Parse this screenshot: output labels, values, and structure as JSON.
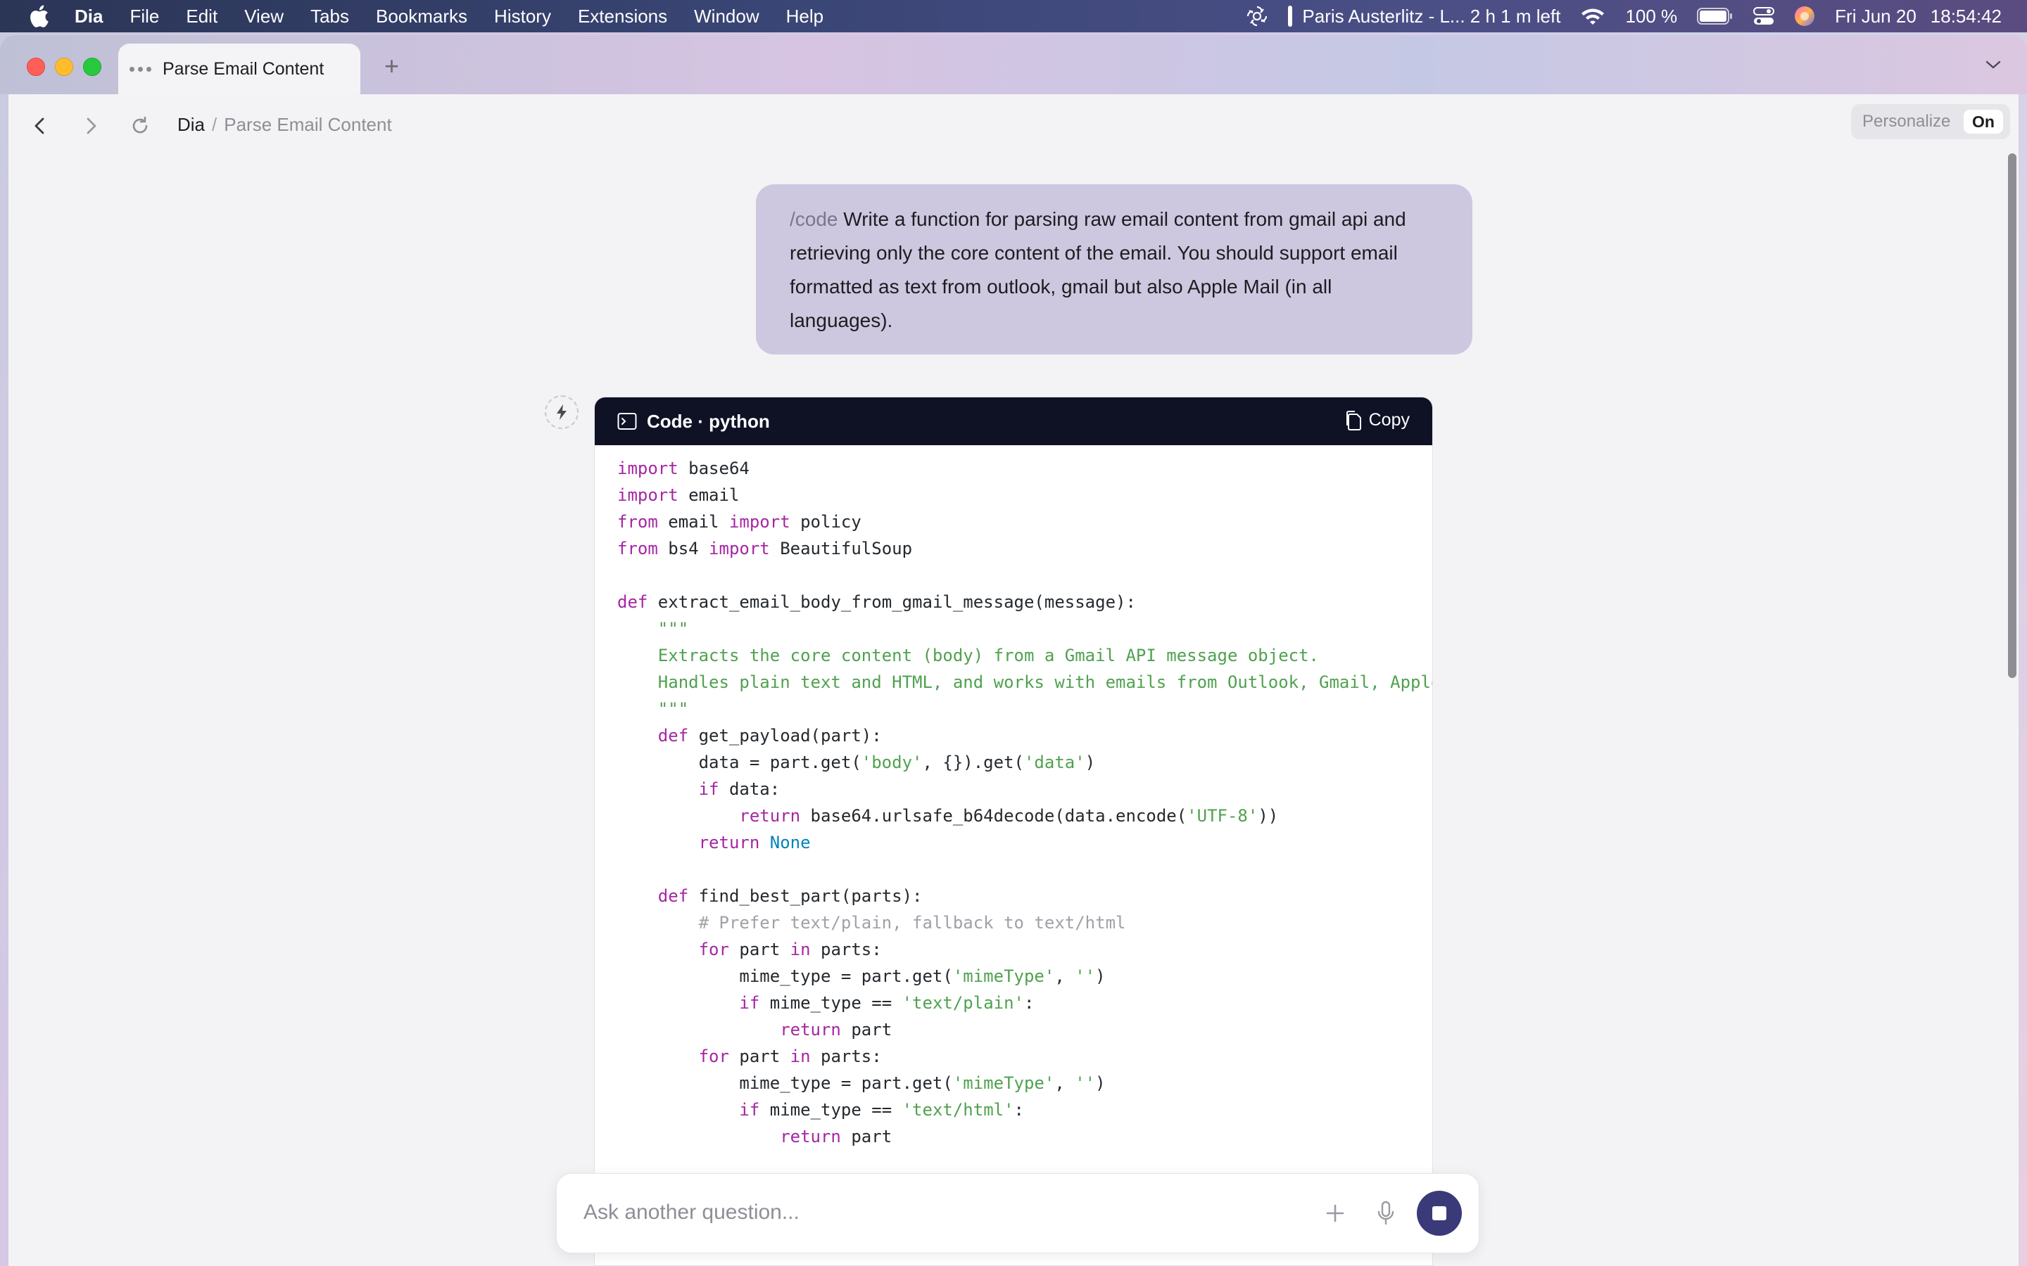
{
  "menubar": {
    "app": "Dia",
    "items": [
      "File",
      "Edit",
      "View",
      "Tabs",
      "Bookmarks",
      "History",
      "Extensions",
      "Window",
      "Help"
    ],
    "status": {
      "trip": "Paris Austerlitz - L... 2 h 1 m left",
      "battery": "100 %",
      "date": "Fri Jun 20",
      "time": "18:54:42"
    }
  },
  "tab": {
    "title": "Parse Email Content"
  },
  "toolbar": {
    "breadcrumb_root": "Dia",
    "breadcrumb_sep": "/",
    "breadcrumb_current": "Parse Email Content",
    "personalize_label": "Personalize",
    "personalize_state": "On"
  },
  "user_message": {
    "command": "/code",
    "text": " Write a function for parsing raw email content from gmail api and retrieving only the core content of the email. You should support email formatted as text from outlook, gmail but also Apple Mail (in all languages)."
  },
  "code_block": {
    "title": "Code · python",
    "copy_label": "Copy",
    "lines": [
      [
        [
          "kw",
          "import"
        ],
        [
          "",
          " base64"
        ]
      ],
      [
        [
          "kw",
          "import"
        ],
        [
          "",
          " email"
        ]
      ],
      [
        [
          "kw",
          "from"
        ],
        [
          "",
          " email "
        ],
        [
          "kw",
          "import"
        ],
        [
          "",
          " policy"
        ]
      ],
      [
        [
          "kw",
          "from"
        ],
        [
          "",
          " bs4 "
        ],
        [
          "kw",
          "import"
        ],
        [
          "",
          " BeautifulSoup"
        ]
      ],
      [],
      [
        [
          "kw",
          "def"
        ],
        [
          "",
          " extract_email_body_from_gmail_message(message):"
        ]
      ],
      [
        [
          "str",
          "    \"\"\""
        ]
      ],
      [
        [
          "str",
          "    Extracts the core content (body) from a Gmail API message object."
        ]
      ],
      [
        [
          "str",
          "    Handles plain text and HTML, and works with emails from Outlook, Gmail, Apple Mail"
        ]
      ],
      [
        [
          "str",
          "    \"\"\""
        ]
      ],
      [
        [
          "",
          "    "
        ],
        [
          "kw",
          "def"
        ],
        [
          "",
          " get_payload(part):"
        ]
      ],
      [
        [
          "",
          "        data = part.get("
        ],
        [
          "str",
          "'body'"
        ],
        [
          "",
          ", {}).get("
        ],
        [
          "str",
          "'data'"
        ],
        [
          "",
          ")"
        ]
      ],
      [
        [
          "",
          "        "
        ],
        [
          "kw",
          "if"
        ],
        [
          "",
          " data:"
        ]
      ],
      [
        [
          "",
          "            "
        ],
        [
          "kw",
          "return"
        ],
        [
          "",
          " base64.urlsafe_b64decode(data.encode("
        ],
        [
          "str",
          "'UTF-8'"
        ],
        [
          "",
          "))"
        ]
      ],
      [
        [
          "",
          "        "
        ],
        [
          "kw",
          "return"
        ],
        [
          "",
          " "
        ],
        [
          "cst",
          "None"
        ]
      ],
      [],
      [
        [
          "",
          "    "
        ],
        [
          "kw",
          "def"
        ],
        [
          "",
          " find_best_part(parts):"
        ]
      ],
      [
        [
          "com",
          "        # Prefer text/plain, fallback to text/html"
        ]
      ],
      [
        [
          "",
          "        "
        ],
        [
          "kw",
          "for"
        ],
        [
          "",
          " part "
        ],
        [
          "kw",
          "in"
        ],
        [
          "",
          " parts:"
        ]
      ],
      [
        [
          "",
          "            mime_type = part.get("
        ],
        [
          "str",
          "'mimeType'"
        ],
        [
          "",
          ", "
        ],
        [
          "str",
          "''"
        ],
        [
          "",
          ")"
        ]
      ],
      [
        [
          "",
          "            "
        ],
        [
          "kw",
          "if"
        ],
        [
          "",
          " mime_type == "
        ],
        [
          "str",
          "'text/plain'"
        ],
        [
          "",
          ":"
        ]
      ],
      [
        [
          "",
          "                "
        ],
        [
          "kw",
          "return"
        ],
        [
          "",
          " part"
        ]
      ],
      [
        [
          "",
          "        "
        ],
        [
          "kw",
          "for"
        ],
        [
          "",
          " part "
        ],
        [
          "kw",
          "in"
        ],
        [
          "",
          " parts:"
        ]
      ],
      [
        [
          "",
          "            mime_type = part.get("
        ],
        [
          "str",
          "'mimeType'"
        ],
        [
          "",
          ", "
        ],
        [
          "str",
          "''"
        ],
        [
          "",
          ")"
        ]
      ],
      [
        [
          "",
          "            "
        ],
        [
          "kw",
          "if"
        ],
        [
          "",
          " mime_type == "
        ],
        [
          "str",
          "'text/html'"
        ],
        [
          "",
          ":"
        ]
      ],
      [
        [
          "",
          "                "
        ],
        [
          "kw",
          "return"
        ],
        [
          "",
          " part"
        ]
      ]
    ]
  },
  "input": {
    "placeholder": "Ask another question..."
  },
  "colors": {
    "bubble": "#cdc8e0",
    "code_header": "#0f1225",
    "keyword": "#a626a4",
    "string": "#50a14f",
    "comment": "#a0a1a7",
    "constant": "#0184bc",
    "stop_button": "#3a3a78"
  },
  "icons": {
    "apple": "apple-icon",
    "chatgpt": "openai-icon",
    "wifi": "wifi-icon",
    "battery": "battery-icon",
    "control_center": "control-center-icon",
    "siri": "siri-icon",
    "back": "chevron-left-icon",
    "forward": "chevron-right-icon",
    "reload": "reload-icon",
    "terminal": "terminal-icon",
    "copy": "copy-icon",
    "plus": "plus-icon",
    "mic": "mic-icon",
    "stop": "stop-icon"
  }
}
